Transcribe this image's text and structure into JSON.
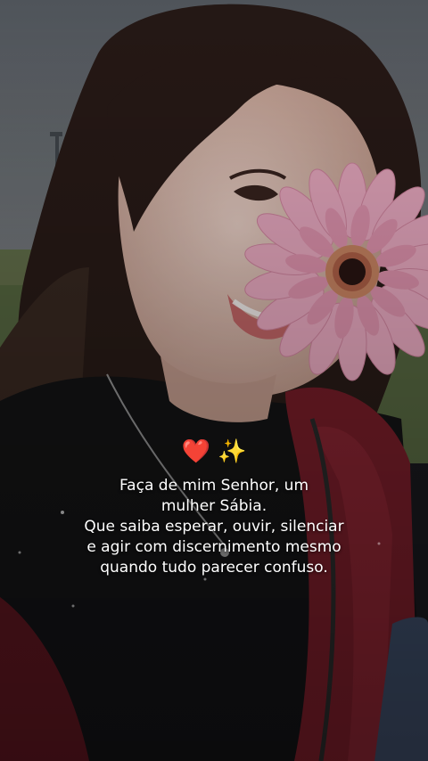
{
  "caption": {
    "emoji_heart": "❤️",
    "emoji_sparkles": "✨",
    "lines": "Faça de mim Senhor, um\nmulher Sábia.\nQue saiba esperar, ouvir, silenciar\ne agir com discernimento mesmo\nquando tudo parecer confuso."
  },
  "colors": {
    "text": "#ffffff",
    "jacket": "#7a1e2a",
    "flower": "#f2a9c6",
    "shirt": "#141416"
  }
}
